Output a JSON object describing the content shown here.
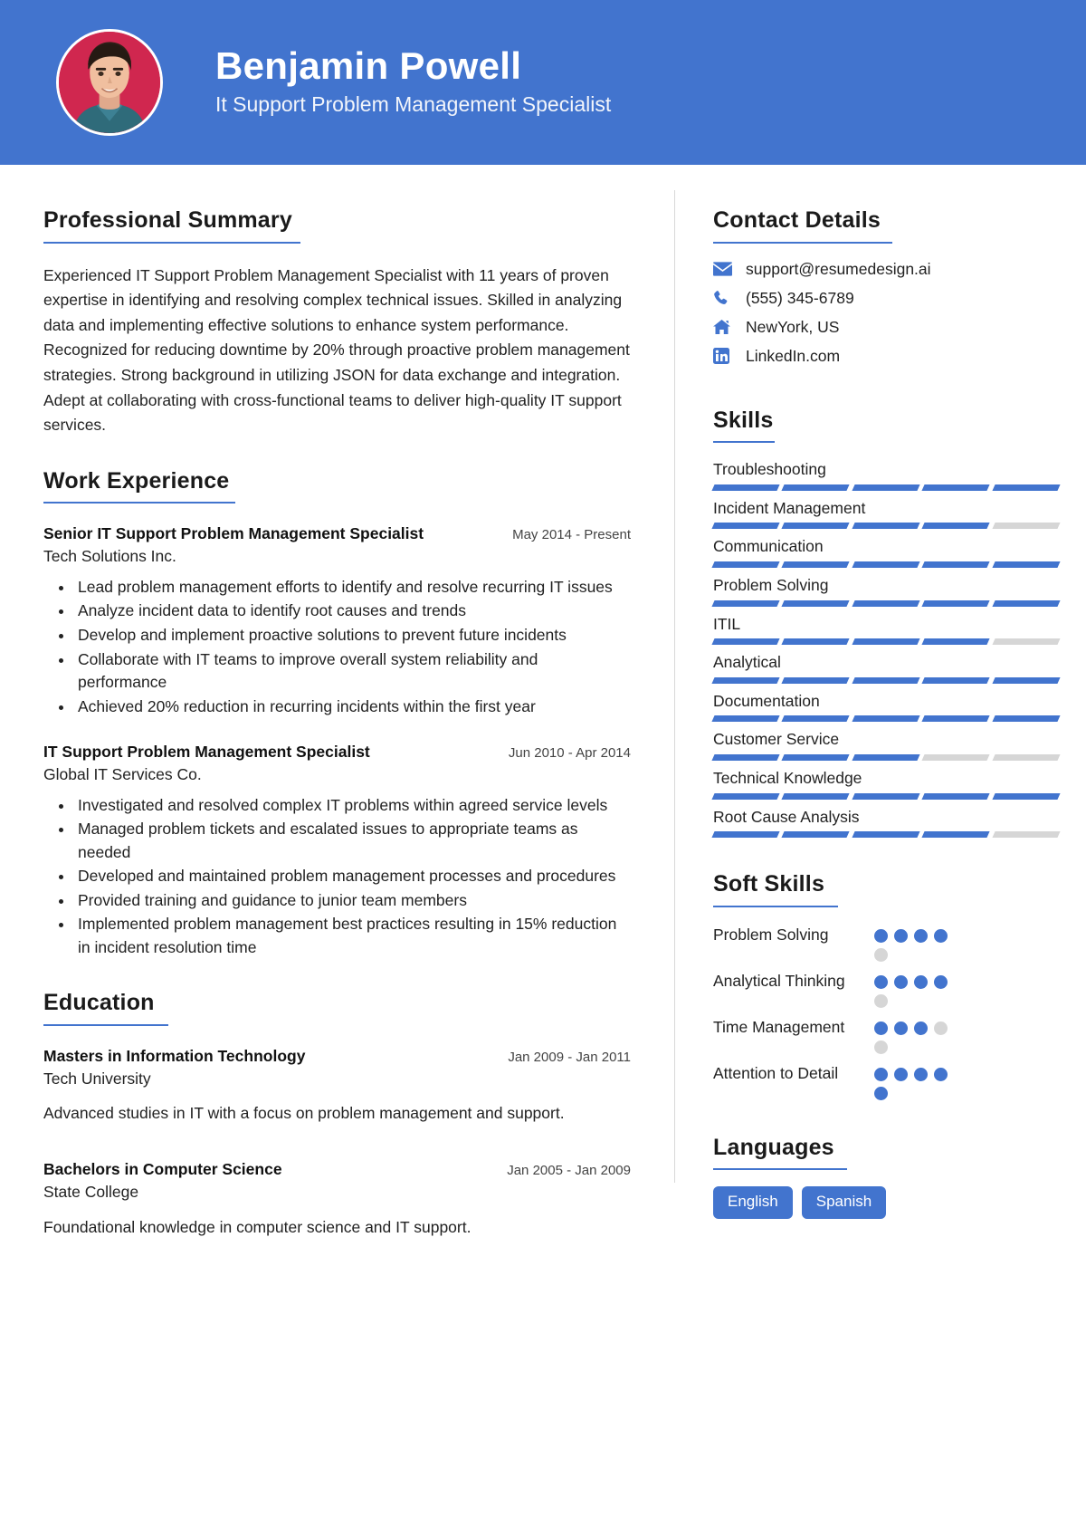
{
  "theme": {
    "accent": "#4274CE",
    "accent_light": "#D6D6D6",
    "avatar_bg": "#D0274F",
    "header_bg": "#4274CE",
    "text": "#222222"
  },
  "header": {
    "name": "Benjamin Powell",
    "job_title": "It Support Problem Management Specialist",
    "avatar_alt": "profile-photo"
  },
  "main": {
    "summary_section": {
      "title": "Professional Summary",
      "text": "Experienced IT Support Problem Management Specialist with 11 years of proven expertise in identifying and resolving complex technical issues. Skilled in analyzing data and implementing effective solutions to enhance system performance. Recognized for reducing downtime by 20% through proactive problem management strategies. Strong background in utilizing JSON for data exchange and integration. Adept at collaborating with cross-functional teams to deliver high-quality IT support services."
    },
    "experience_section": {
      "title": "Work Experience",
      "entries": [
        {
          "role": "Senior IT Support Problem Management Specialist",
          "date": "May 2014 - Present",
          "organization": "Tech Solutions Inc.",
          "bullets": [
            "Lead problem management efforts to identify and resolve recurring IT issues",
            "Analyze incident data to identify root causes and trends",
            "Develop and implement proactive solutions to prevent future incidents",
            "Collaborate with IT teams to improve overall system reliability and performance",
            "Achieved 20% reduction in recurring incidents within the first year"
          ]
        },
        {
          "role": "IT Support Problem Management Specialist",
          "date": "Jun 2010 - Apr 2014",
          "organization": "Global IT Services Co.",
          "bullets": [
            "Investigated and resolved complex IT problems within agreed service levels",
            "Managed problem tickets and escalated issues to appropriate teams as needed",
            "Developed and maintained problem management processes and procedures",
            "Provided training and guidance to junior team members",
            "Implemented problem management best practices resulting in 15% reduction in incident resolution time"
          ]
        }
      ]
    },
    "education_section": {
      "title": "Education",
      "entries": [
        {
          "degree": "Masters in Information Technology",
          "date": "Jan 2009 - Jan 2011",
          "institution": "Tech University",
          "description": "Advanced studies in IT with a focus on problem management and support."
        },
        {
          "degree": "Bachelors in Computer Science",
          "date": "Jan 2005 - Jan 2009",
          "institution": "State College",
          "description": "Foundational knowledge in computer science and IT support."
        }
      ]
    }
  },
  "sidebar": {
    "contact_section": {
      "title": "Contact Details",
      "items": [
        {
          "icon": "email-icon",
          "value": "support@resumedesign.ai"
        },
        {
          "icon": "phone-icon",
          "value": "(555) 345-6789"
        },
        {
          "icon": "home-icon",
          "value": "NewYork, US"
        },
        {
          "icon": "linkedin-icon",
          "value": "LinkedIn.com"
        }
      ]
    },
    "skills_section": {
      "title": "Skills",
      "segments_total": 5,
      "items": [
        {
          "name": "Troubleshooting",
          "filled": 5
        },
        {
          "name": "Incident Management",
          "filled": 4
        },
        {
          "name": "Communication",
          "filled": 5
        },
        {
          "name": "Problem Solving",
          "filled": 5
        },
        {
          "name": "ITIL",
          "filled": 4
        },
        {
          "name": "Analytical",
          "filled": 5
        },
        {
          "name": "Documentation",
          "filled": 5
        },
        {
          "name": "Customer Service",
          "filled": 3
        },
        {
          "name": "Technical Knowledge",
          "filled": 5
        },
        {
          "name": "Root Cause Analysis",
          "filled": 4
        }
      ]
    },
    "soft_skills_section": {
      "title": "Soft Skills",
      "dots_total": 5,
      "items": [
        {
          "name": "Problem Solving",
          "filled": 4
        },
        {
          "name": "Analytical Thinking",
          "filled": 4
        },
        {
          "name": "Time Management",
          "filled": 3
        },
        {
          "name": "Attention to Detail",
          "filled": 5
        }
      ]
    },
    "languages_section": {
      "title": "Languages",
      "items": [
        "English",
        "Spanish"
      ]
    }
  }
}
